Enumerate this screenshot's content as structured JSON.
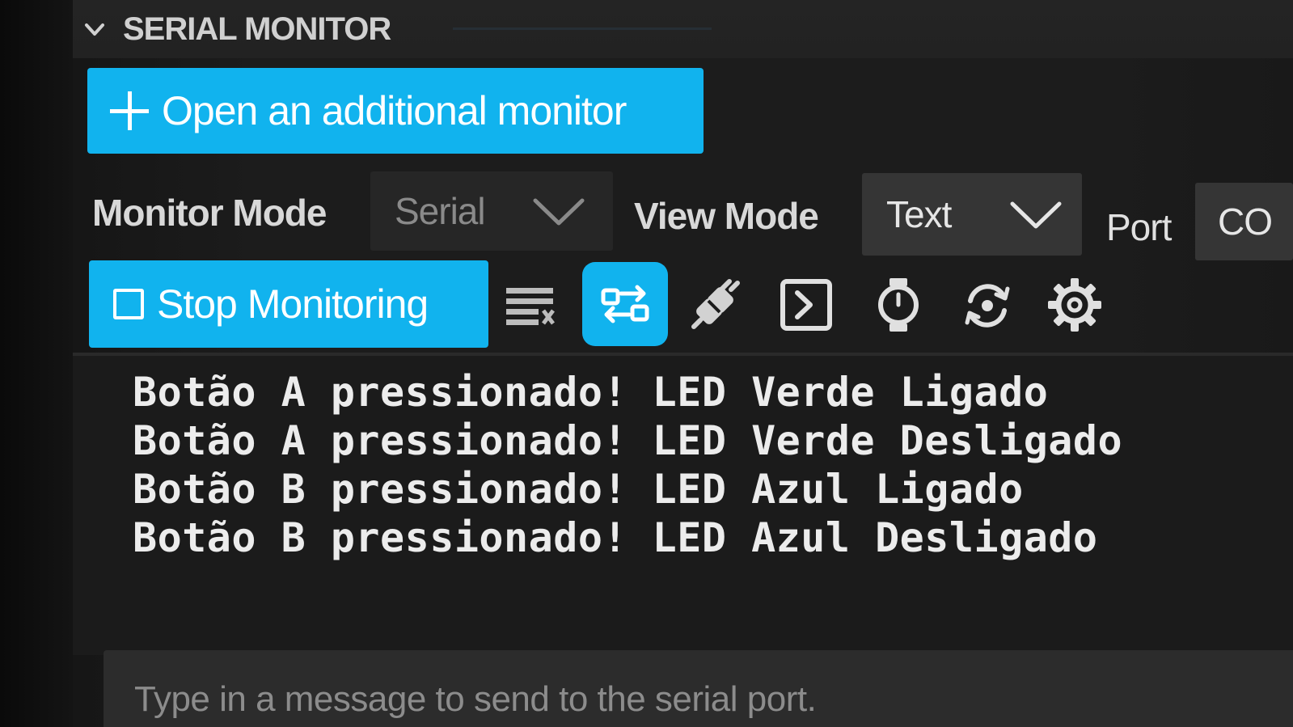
{
  "section": {
    "title": "SERIAL MONITOR"
  },
  "open_monitor_button": {
    "label": "Open an additional monitor",
    "icon": "plus-icon"
  },
  "monitor_mode": {
    "label": "Monitor Mode",
    "selected": "Serial"
  },
  "view_mode": {
    "label": "View Mode",
    "selected": "Text"
  },
  "port": {
    "label": "Port",
    "selected": "CO"
  },
  "toolbar": {
    "stop_label": "Stop Monitoring",
    "icons": [
      "clear-output-icon",
      "toggle-line-ending-icon",
      "connect-link-icon",
      "terminal-icon",
      "timestamp-icon",
      "autoscroll-icon",
      "settings-gear-icon"
    ]
  },
  "output": {
    "lines": [
      "Botão A pressionado! LED Verde Ligado",
      "Botão A pressionado! LED Verde Desligado",
      "Botão B pressionado! LED Azul Ligado",
      "Botão B pressionado! LED Azul Desligado"
    ]
  },
  "message_input": {
    "placeholder": "Type in a message to send to the serial port."
  },
  "colors": {
    "accent": "#11b3ee",
    "background": "#1b1b1b",
    "select_bg": "#2c2c2c",
    "text": "#ececec"
  }
}
